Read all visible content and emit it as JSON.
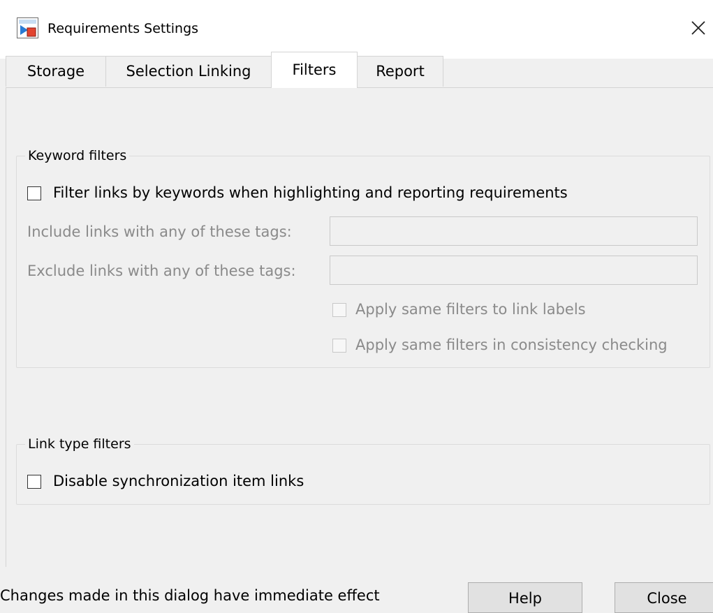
{
  "window": {
    "title": "Requirements Settings",
    "icon": "simulink-model-icon",
    "close_glyph": "✕"
  },
  "tabs": [
    {
      "label": "Storage",
      "active": false
    },
    {
      "label": "Selection Linking",
      "active": false
    },
    {
      "label": "Filters",
      "active": true
    },
    {
      "label": "Report",
      "active": false
    }
  ],
  "keyword_filters": {
    "legend": "Keyword filters",
    "filter_checkbox": {
      "label": "Filter links by keywords when highlighting and reporting requirements",
      "checked": false
    },
    "include": {
      "label": "Include links with any of these tags:",
      "value": "",
      "enabled": false
    },
    "exclude": {
      "label": "Exclude links with any of these tags:",
      "value": "",
      "enabled": false
    },
    "apply_link_labels": {
      "label": "Apply same filters to link labels",
      "checked": false,
      "enabled": false
    },
    "apply_consistency": {
      "label": "Apply same filters in consistency checking",
      "checked": false,
      "enabled": false
    }
  },
  "link_type_filters": {
    "legend": "Link type filters",
    "disable_sync": {
      "label": "Disable synchronization item links",
      "checked": false
    }
  },
  "footer": {
    "status": "Changes made in this dialog have immediate effect",
    "help_label": "Help",
    "close_label": "Close"
  },
  "colors": {
    "window_bg": "#f0f0f0",
    "titlebar_bg": "#ffffff",
    "disabled_text": "#8a8a8a",
    "border": "#d4d4d4"
  }
}
